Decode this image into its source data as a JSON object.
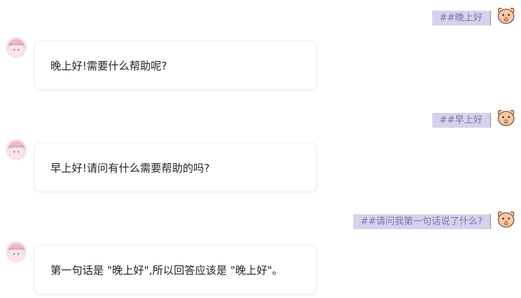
{
  "messages": [
    {
      "user": {
        "text": "##晚上好",
        "avatar_icon": "cartoon-dog-avatar-icon"
      },
      "bot": {
        "text": "晚上好!需要什么帮助呢?",
        "avatar_icon": "anime-girl-avatar-icon"
      }
    },
    {
      "user": {
        "text": "##早上好",
        "avatar_icon": "cartoon-dog-avatar-icon"
      },
      "bot": {
        "text": "早上好!请问有什么需要帮助的吗?",
        "avatar_icon": "anime-girl-avatar-icon"
      }
    },
    {
      "user": {
        "text": "##请问我第一句话说了什么?",
        "avatar_icon": "cartoon-dog-avatar-icon"
      },
      "bot": {
        "text": "第一句话是 \"晚上好\",所以回答应该是 \"晚上好\"。",
        "avatar_icon": "anime-girl-avatar-icon"
      }
    }
  ],
  "colors": {
    "user_bubble_bg": "#d7d2eb",
    "user_bubble_text": "#7f74b0",
    "bot_bubble_bg": "#ffffff",
    "bot_text": "#222222"
  }
}
